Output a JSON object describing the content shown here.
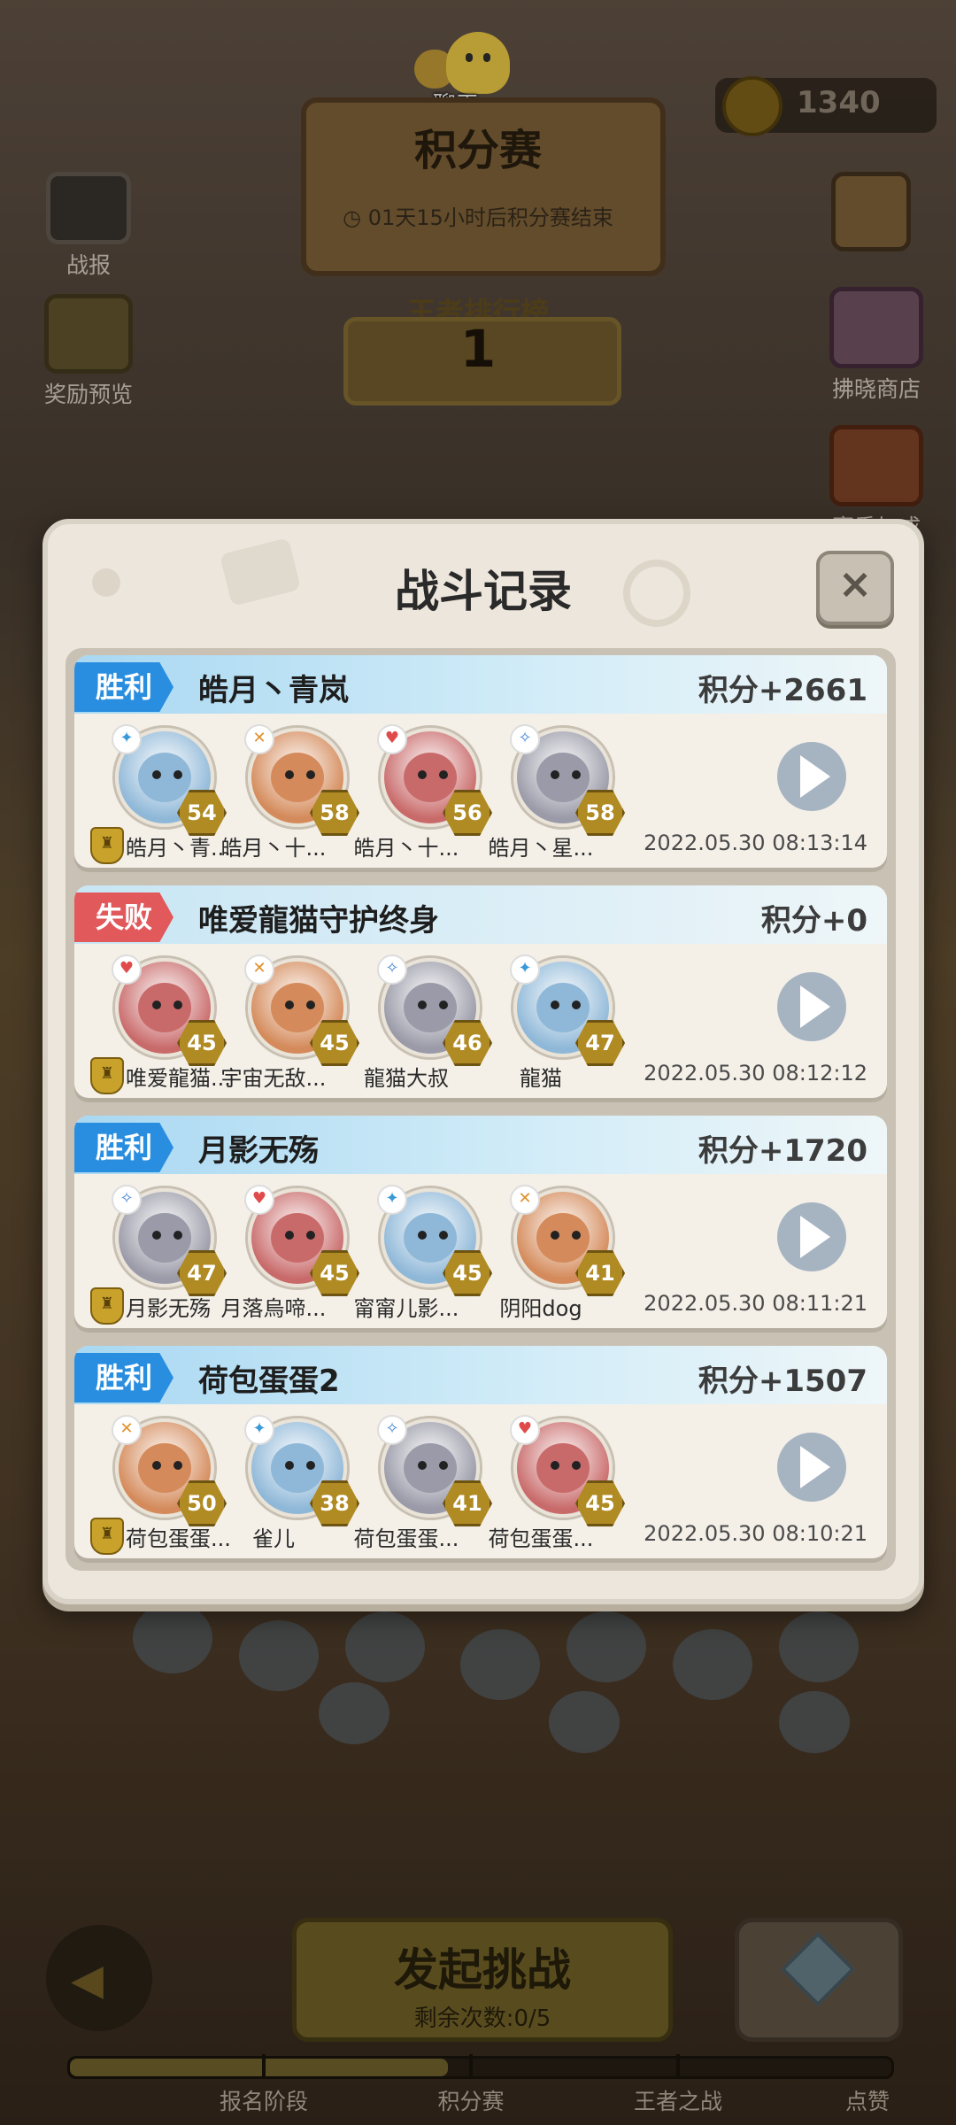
{
  "header": {
    "chat_label": "聊天",
    "title": "积分赛",
    "countdown": "01天15小时后积分赛结束",
    "coins": "1340",
    "rank_label": "王者排行榜",
    "rank_value": "1"
  },
  "side_left": [
    {
      "label": "战报",
      "icon": "tv-icon"
    },
    {
      "label": "奖励预览",
      "icon": "treasure-icon"
    }
  ],
  "side_right": [
    {
      "label": "",
      "icon": "info-icon"
    },
    {
      "label": "拂晓商店",
      "icon": "shop-icon"
    },
    {
      "label": "赛季加成",
      "icon": "bonus-icon"
    }
  ],
  "dialog": {
    "title": "战斗记录",
    "close": "×",
    "records": [
      {
        "result": "胜利",
        "outcome": "win",
        "opponent": "皓月丶青岚",
        "score": "积分+2661",
        "time": "2022.05.30 08:13:14",
        "heroes": [
          {
            "name": "皓月丶青...",
            "level": "54",
            "element": "water"
          },
          {
            "name": "皓月丶十...",
            "level": "58",
            "element": "fire"
          },
          {
            "name": "皓月丶十...",
            "level": "56",
            "element": "heart"
          },
          {
            "name": "皓月丶星...",
            "level": "58",
            "element": "sword"
          }
        ]
      },
      {
        "result": "失败",
        "outcome": "lose",
        "opponent": "唯爱龍猫守护终身",
        "score": "积分+0",
        "time": "2022.05.30 08:12:12",
        "heroes": [
          {
            "name": "唯爱龍猫...",
            "level": "45",
            "element": "heart"
          },
          {
            "name": "宇宙无敌...",
            "level": "45",
            "element": "fire"
          },
          {
            "name": "龍猫大叔",
            "level": "46",
            "element": "sword"
          },
          {
            "name": "龍猫",
            "level": "47",
            "element": "water"
          }
        ]
      },
      {
        "result": "胜利",
        "outcome": "win",
        "opponent": "月影无殇",
        "score": "积分+1720",
        "time": "2022.05.30 08:11:21",
        "heroes": [
          {
            "name": "月影无殇",
            "level": "47",
            "element": "sword"
          },
          {
            "name": "月落烏啼...",
            "level": "45",
            "element": "heart"
          },
          {
            "name": "甯甯儿影...",
            "level": "45",
            "element": "water"
          },
          {
            "name": "阴阳dog",
            "level": "41",
            "element": "fire"
          }
        ]
      },
      {
        "result": "胜利",
        "outcome": "win",
        "opponent": "荷包蛋蛋2",
        "score": "积分+1507",
        "time": "2022.05.30 08:10:21",
        "heroes": [
          {
            "name": "荷包蛋蛋...",
            "level": "50",
            "element": "fire"
          },
          {
            "name": "雀儿",
            "level": "38",
            "element": "water"
          },
          {
            "name": "荷包蛋蛋...",
            "level": "41",
            "element": "sword"
          },
          {
            "name": "荷包蛋蛋...",
            "level": "45",
            "element": "heart"
          }
        ]
      }
    ]
  },
  "bottom": {
    "challenge_title": "发起挑战",
    "challenge_sub": "剩余次数:0/5",
    "stages": [
      "报名阶段",
      "积分赛",
      "王者之战",
      "点赞"
    ],
    "stage_progress": 0.46
  },
  "colors": {
    "win_tag": "#2a8ee0",
    "lose_tag": "#e2595c",
    "level_badge": "#b08a22"
  }
}
